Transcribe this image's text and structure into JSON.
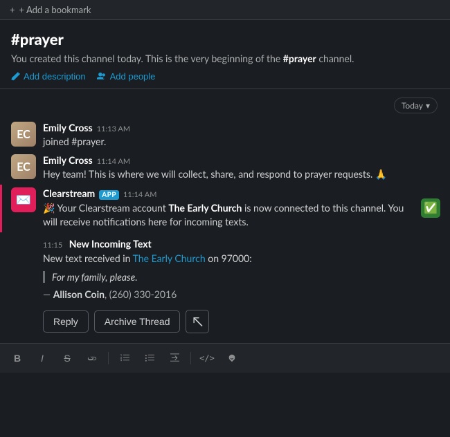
{
  "bookmark_bar": {
    "label": "+ Add a bookmark"
  },
  "channel": {
    "name": "#prayer",
    "description_prefix": "You created this channel today. This is the very beginning of the ",
    "description_bold": "#prayer",
    "description_suffix": " channel.",
    "action_description": "Add description",
    "action_people": "Add people"
  },
  "date_divider": {
    "label": "Today",
    "chevron": "▾"
  },
  "messages": [
    {
      "id": "msg1",
      "sender": "Emily Cross",
      "timestamp": "11:13 AM",
      "text": "joined #prayer.",
      "type": "join"
    },
    {
      "id": "msg2",
      "sender": "Emily Cross",
      "timestamp": "11:14 AM",
      "text": "Hey team! This is where we will collect, share, and respond to prayer requests. 🙏",
      "type": "normal"
    },
    {
      "id": "msg3",
      "sender": "Clearstream",
      "app_badge": "APP",
      "timestamp": "11:14 AM",
      "text_prefix": "🎉 Your Clearstream account ",
      "text_bold": "The Early Church",
      "text_suffix": " is now connected to this channel. You will receive notifications here for incoming texts.",
      "type": "app"
    }
  ],
  "incoming_text": {
    "time": "11:15",
    "title": "New Incoming Text",
    "body_prefix": "New text received in ",
    "body_link": "The Early Church",
    "body_suffix": " on 97000:",
    "quote": "For my family, please.",
    "signature": "— ",
    "signature_name": "Allison Coin",
    "signature_contact": ", (260) 330-2016"
  },
  "action_buttons": {
    "reply": "Reply",
    "archive": "Archive Thread",
    "cursor_icon": "↖"
  },
  "composer": {
    "toolbar": {
      "bold": "B",
      "italic": "I",
      "strikethrough": "S",
      "link": "🔗",
      "ol": "ol",
      "ul": "ul",
      "indent": "⇥",
      "code": "</>",
      "more": "⤴"
    }
  }
}
